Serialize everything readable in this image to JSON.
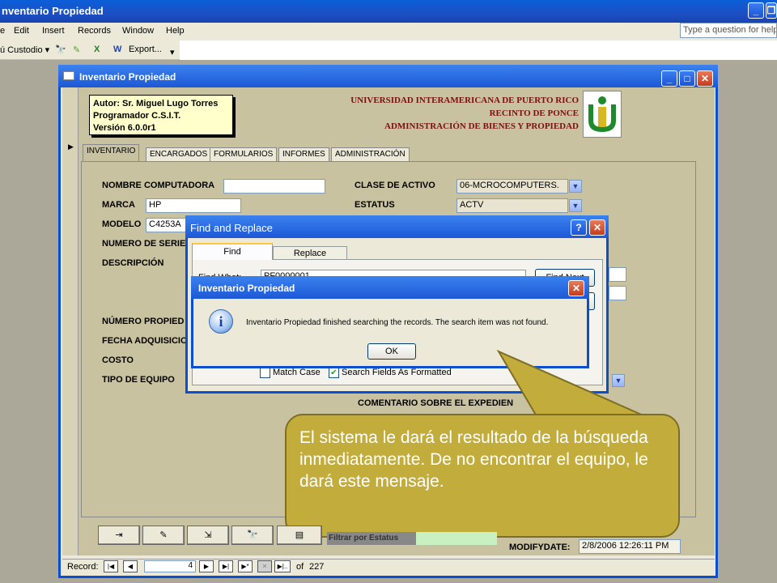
{
  "app": {
    "title": "nventario Propiedad",
    "min_icon": "minimize-icon",
    "restore_icon": "restore-icon"
  },
  "menu": {
    "items": [
      "e",
      "Edit",
      "Insert",
      "Records",
      "Window",
      "Help"
    ],
    "ask_placeholder": "Type a question for help"
  },
  "toolbar": {
    "menu_label": "ú Custodio ▾",
    "export_label": "Export..."
  },
  "form": {
    "title": "Inventario Propiedad",
    "author_lines": [
      "Autor: Sr. Miguel Lugo Torres",
      "Programador C.S.I.T.",
      "Versión 6.0.0r1"
    ],
    "university_lines": [
      "UNIVERSIDAD INTERAMERICANA DE PUERTO RICO",
      "RECINTO DE PONCE",
      "ADMINISTRACIÓN DE BIENES Y PROPIEDAD"
    ],
    "tabs": [
      "INVENTARIO",
      "ENCARGADOS",
      "FORMULARIOS",
      "INFORMES",
      "ADMINISTRACIÓN"
    ],
    "labels": {
      "nombre": "NOMBRE COMPUTADORA",
      "marca": "MARCA",
      "modelo": "MODELO",
      "serie": "NUMERO DE SERIE",
      "descripcion": "DESCRIPCIÓN",
      "numero_propiedad": "NÚMERO PROPIED",
      "fecha": "FECHA ADQUISICIO",
      "costo": "COSTO",
      "tipo": "TIPO DE EQUIPO",
      "clase": "CLASE DE ACTIVO",
      "estatus": "ESTATUS",
      "comentario": "COMENTARIO SOBRE EL EXPEDIEN"
    },
    "values": {
      "nombre": "",
      "marca": "HP",
      "modelo": "C4253A",
      "clase": "06-MCROCOMPUTERS.",
      "estatus": "ACTV"
    },
    "modify_label": "MODIFYDATE:",
    "modify_value": "2/8/2006 12:26:11 PM",
    "filter_label": "Filtrar por Estatus"
  },
  "find_replace": {
    "title": "Find and Replace",
    "help_label": "?",
    "tab_find": "Find",
    "tab_replace": "Replace",
    "find_what_label": "Find What:",
    "find_what_value": "PF0000001",
    "find_next": "Find Next",
    "match_case": "Match Case",
    "search_formatted": "Search Fields As Formatted"
  },
  "message": {
    "title": "Inventario Propiedad",
    "text": "Inventario Propiedad finished searching the records. The search item was not found.",
    "ok": "OK"
  },
  "callout": {
    "text": "El sistema le dará el resultado de la búsqueda inmediatamente. De no encontrar el equipo, le dará este mensaje."
  },
  "record_nav": {
    "label": "Record:",
    "current": "4",
    "of_label": "of",
    "total": "227"
  }
}
